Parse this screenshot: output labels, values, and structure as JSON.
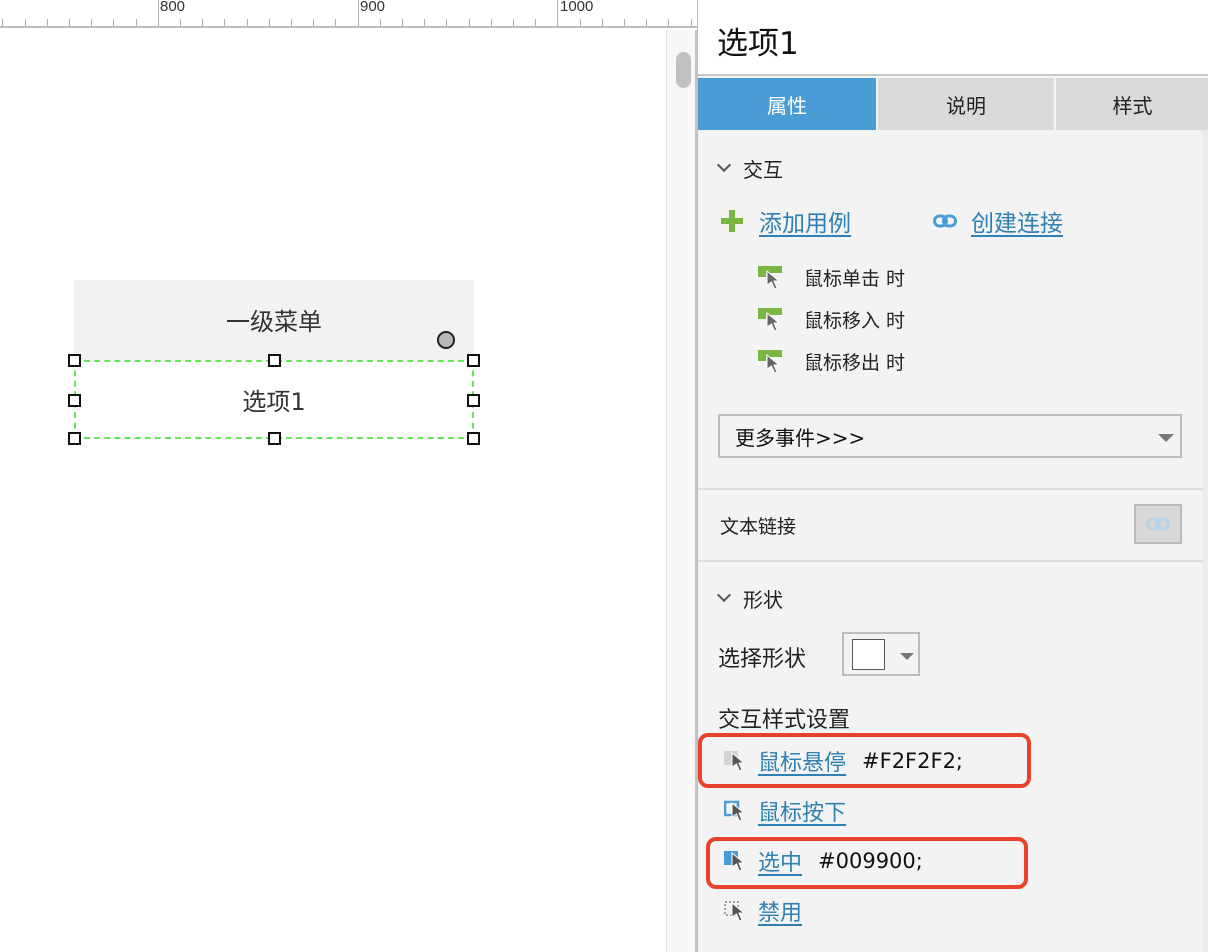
{
  "ruler": {
    "labels": [
      "800",
      "900",
      "1000"
    ]
  },
  "canvas": {
    "menu_header_text": "一级菜单",
    "option_text": "选项1"
  },
  "panel": {
    "title": "选项1",
    "tabs": [
      {
        "label": "属性",
        "active": true
      },
      {
        "label": "说明",
        "active": false
      },
      {
        "label": "样式",
        "active": false
      }
    ],
    "interaction_section": {
      "title": "交互",
      "add_case_label": "添加用例",
      "create_link_label": "创建连接",
      "events": [
        {
          "label": "鼠标单击 时",
          "icon": "cursor-event-icon"
        },
        {
          "label": "鼠标移入 时",
          "icon": "cursor-event-icon"
        },
        {
          "label": "鼠标移出 时",
          "icon": "cursor-event-icon"
        }
      ],
      "more_events_select": "更多事件>>>"
    },
    "text_link": {
      "label": "文本链接",
      "icon": "chain-link-icon"
    },
    "shape_section": {
      "title": "形状",
      "select_shape_label": "选择形状",
      "interaction_style_title": "交互样式设置",
      "styles": [
        {
          "label": "鼠标悬停",
          "value": "#F2F2F2;",
          "icon": "hover-style-icon",
          "highlighted": true
        },
        {
          "label": "鼠标按下",
          "value": "",
          "icon": "mousedown-style-icon",
          "highlighted": false
        },
        {
          "label": "选中",
          "value": "#009900;",
          "icon": "selected-style-icon",
          "highlighted": true
        },
        {
          "label": "禁用",
          "value": "",
          "icon": "disabled-style-icon",
          "highlighted": false
        }
      ]
    }
  },
  "colors": {
    "accent_tab": "#4a9dd4",
    "link": "#2f80b3",
    "plus_green": "#7ab642",
    "highlight_red": "#e8432a",
    "selection_dash": "#66e65a"
  }
}
